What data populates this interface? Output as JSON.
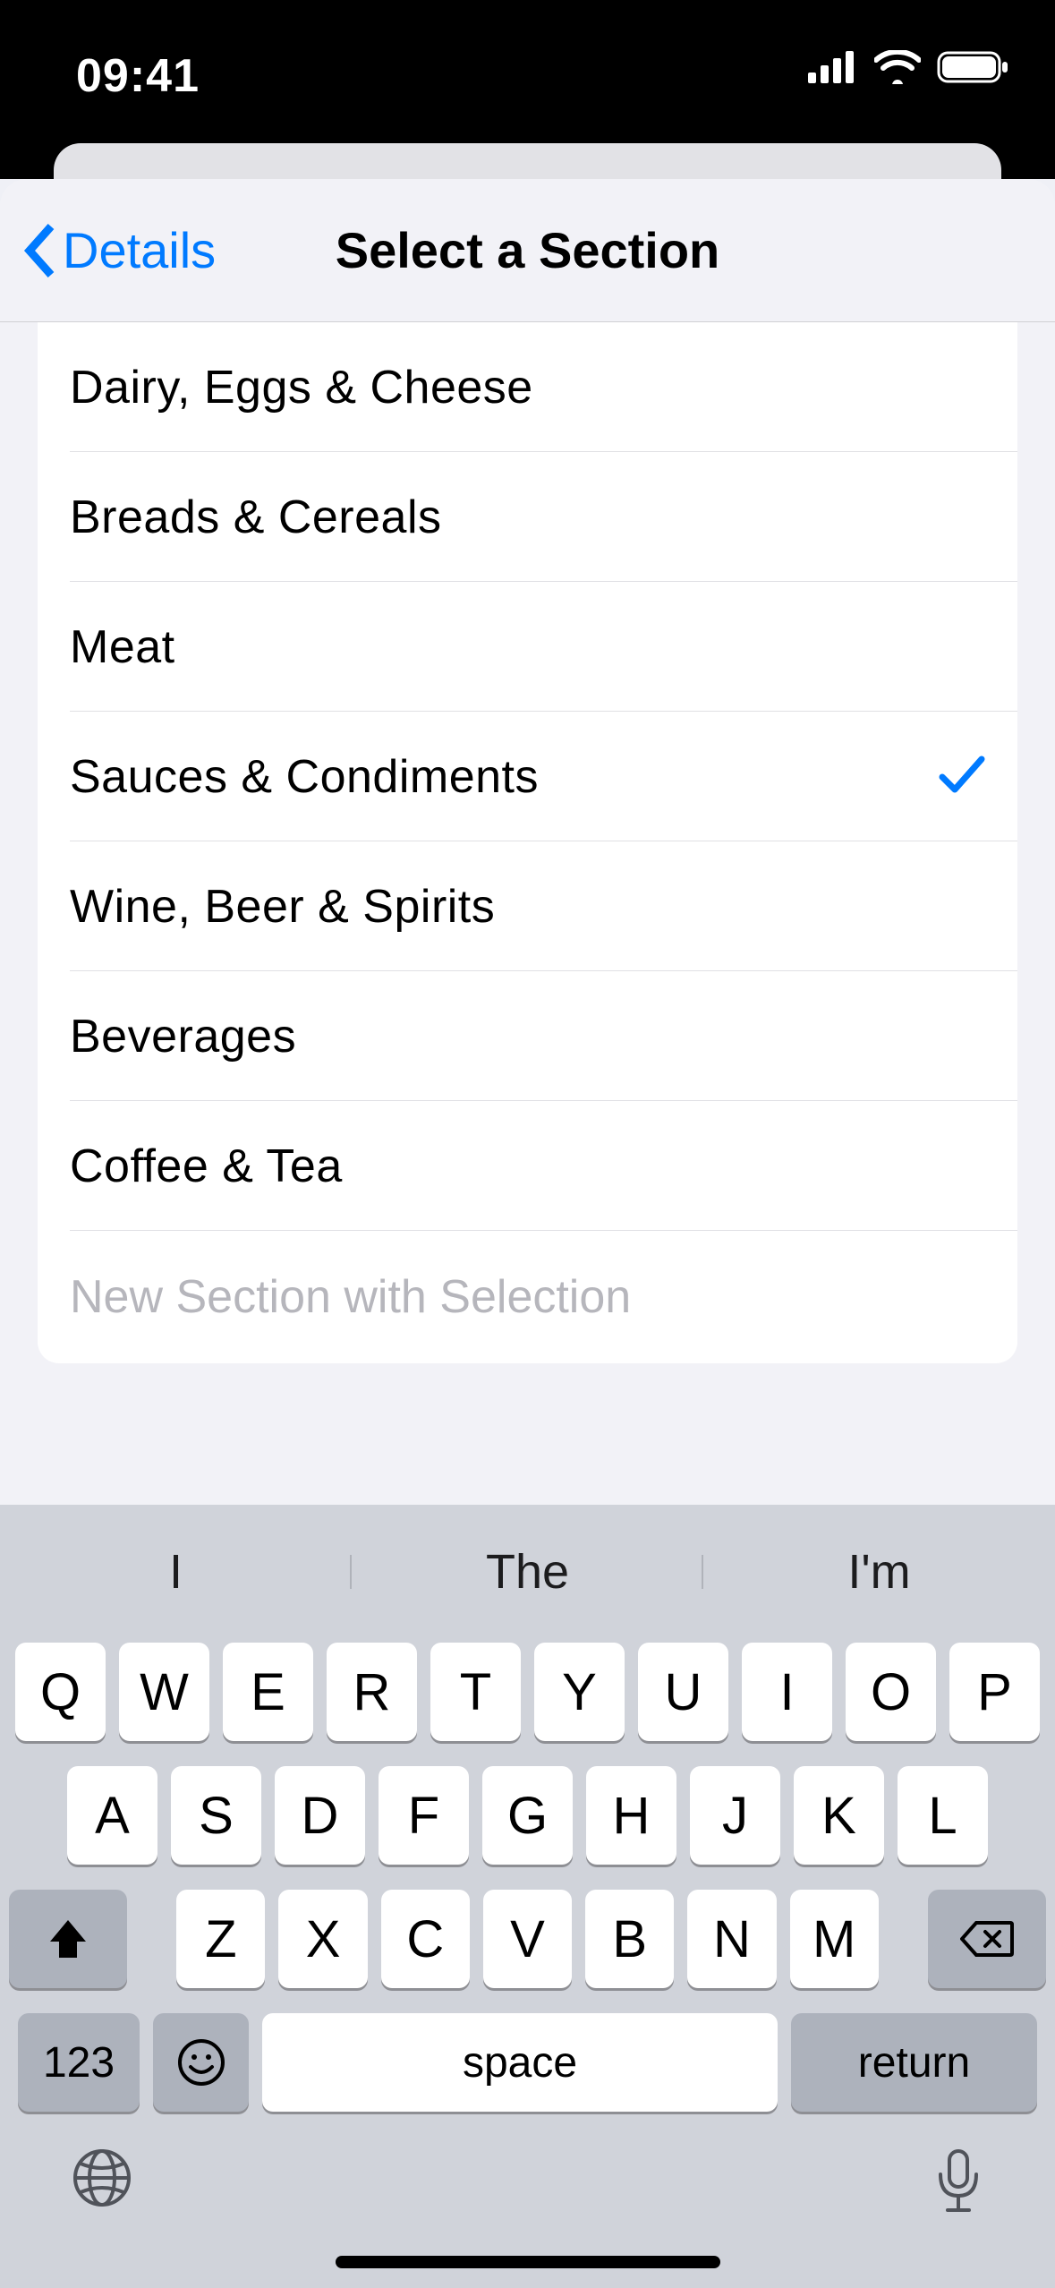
{
  "status": {
    "time": "09:41"
  },
  "nav": {
    "back": "Details",
    "title": "Select a Section"
  },
  "sections": [
    {
      "label": "Dairy, Eggs & Cheese",
      "selected": false
    },
    {
      "label": "Breads & Cereals",
      "selected": false
    },
    {
      "label": "Meat",
      "selected": false
    },
    {
      "label": "Sauces & Condiments",
      "selected": true
    },
    {
      "label": "Wine, Beer & Spirits",
      "selected": false
    },
    {
      "label": "Beverages",
      "selected": false
    },
    {
      "label": "Coffee & Tea",
      "selected": false
    }
  ],
  "newSection": {
    "placeholder": "New Section with Selection",
    "value": ""
  },
  "keyboard": {
    "suggestions": [
      "I",
      "The",
      "I'm"
    ],
    "row1": [
      "Q",
      "W",
      "E",
      "R",
      "T",
      "Y",
      "U",
      "I",
      "O",
      "P"
    ],
    "row2": [
      "A",
      "S",
      "D",
      "F",
      "G",
      "H",
      "J",
      "K",
      "L"
    ],
    "row3": [
      "Z",
      "X",
      "C",
      "V",
      "B",
      "N",
      "M"
    ],
    "numKey": "123",
    "space": "space",
    "return": "return"
  }
}
